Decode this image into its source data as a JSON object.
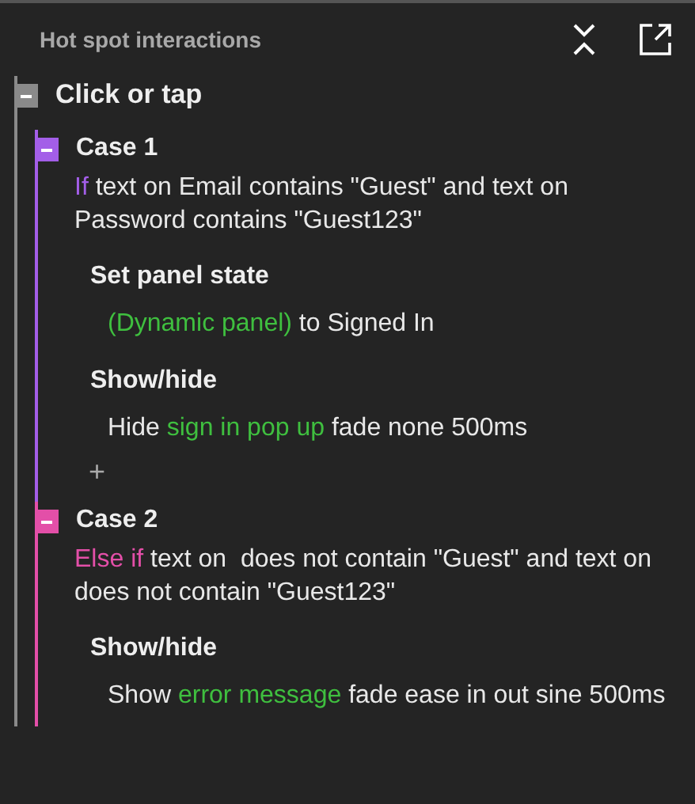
{
  "panel": {
    "title": "Hot spot interactions"
  },
  "event": {
    "label": "Click or tap",
    "expanded": true,
    "cases": [
      {
        "label": "Case 1",
        "color": "#a35ee8",
        "expanded": true,
        "condition": [
          {
            "kind": "keyword",
            "text": "If"
          },
          {
            "kind": "plain",
            "text": " text on Email contains \"Guest\" and text on Password contains \"Guest123\""
          }
        ],
        "actions": [
          {
            "label": "Set panel state",
            "detail": [
              {
                "kind": "target",
                "text": "(Dynamic panel)"
              },
              {
                "kind": "plain",
                "text": " to Signed In"
              }
            ]
          },
          {
            "label": "Show/hide",
            "detail": [
              {
                "kind": "plain",
                "text": "Hide "
              },
              {
                "kind": "target",
                "text": "sign in pop up"
              },
              {
                "kind": "plain",
                "text": " fade none 500ms"
              }
            ]
          }
        ],
        "add_button": "+"
      },
      {
        "label": "Case 2",
        "color": "#e34fa8",
        "expanded": true,
        "condition": [
          {
            "kind": "keyword",
            "text": "Else if"
          },
          {
            "kind": "plain",
            "text": " text on  does not contain \"Guest\" and text on  does not contain \"Guest123\""
          }
        ],
        "actions": [
          {
            "label": "Show/hide",
            "detail": [
              {
                "kind": "plain",
                "text": "Show "
              },
              {
                "kind": "target",
                "text": "error message"
              },
              {
                "kind": "plain",
                "text": " fade ease in out sine 500ms"
              }
            ]
          }
        ]
      }
    ]
  }
}
